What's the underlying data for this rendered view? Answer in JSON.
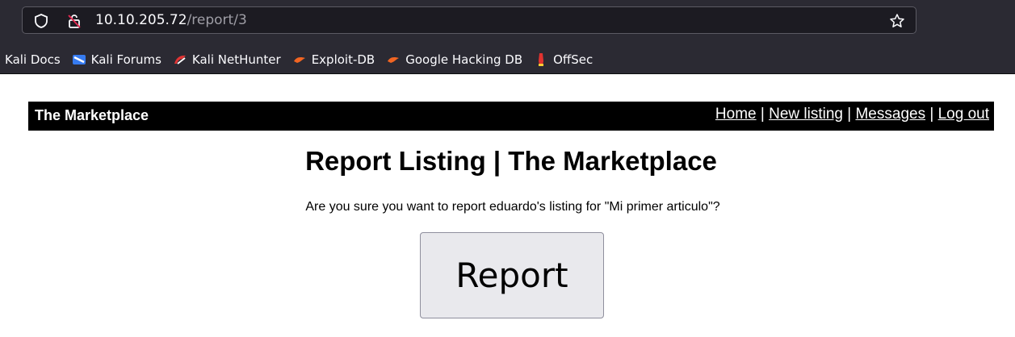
{
  "browser": {
    "url_host": "10.10.205.72",
    "url_path": "/report/3",
    "bookmarks": [
      {
        "label": "Kali Docs",
        "icon": "none"
      },
      {
        "label": "Kali Forums",
        "icon": "kali-forums-icon"
      },
      {
        "label": "Kali NetHunter",
        "icon": "nethunter-icon"
      },
      {
        "label": "Exploit-DB",
        "icon": "exploit-db-icon"
      },
      {
        "label": "Google Hacking DB",
        "icon": "ghdb-icon"
      },
      {
        "label": "OffSec",
        "icon": "offsec-icon"
      }
    ]
  },
  "header": {
    "brand": "The Marketplace",
    "nav": {
      "home": "Home",
      "new_listing": "New listing",
      "messages": "Messages",
      "logout": "Log out",
      "separator": "|"
    }
  },
  "main": {
    "title": "Report Listing | The Marketplace",
    "question": "Are you sure you want to report eduardo's listing for \"Mi primer articulo\"?",
    "report_button": "Report"
  },
  "colors": {
    "chrome_bg": "#2b2a33",
    "header_bg": "#000000",
    "button_bg": "#e9e9ed"
  }
}
